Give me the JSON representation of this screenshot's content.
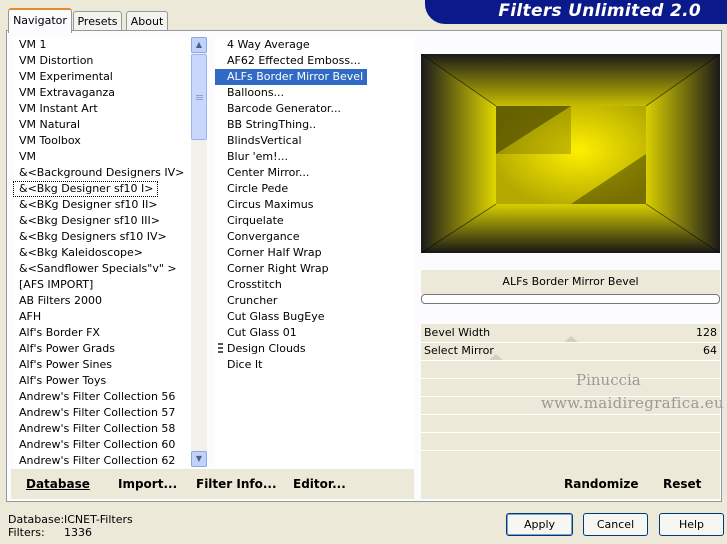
{
  "banner": {
    "title": "Filters Unlimited 2.0"
  },
  "tabs": [
    {
      "label": "Navigator",
      "active": true
    },
    {
      "label": "Presets",
      "active": false
    },
    {
      "label": "About",
      "active": false
    }
  ],
  "categories": {
    "items": [
      "VM 1",
      "VM Distortion",
      "VM Experimental",
      "VM Extravaganza",
      "VM Instant Art",
      "VM Natural",
      "VM Toolbox",
      "VM",
      "&<Background Designers IV>",
      "&<Bkg Designer sf10 I>",
      "&<BKg Designer sf10 II>",
      "&<Bkg Designer sf10 III>",
      "&<Bkg Designers sf10 IV>",
      "&<Bkg Kaleidoscope>",
      "&<Sandflower Specials\"v\" >",
      "[AFS IMPORT]",
      "AB Filters 2000",
      "AFH",
      "Alf's Border FX",
      "Alf's Power Grads",
      "Alf's Power Sines",
      "Alf's Power Toys",
      "Andrew's Filter Collection 56",
      "Andrew's Filter Collection 57",
      "Andrew's Filter Collection 58",
      "Andrew's Filter Collection 60",
      "Andrew's Filter Collection 62"
    ],
    "focused_index": 9
  },
  "filters": {
    "items": [
      "4 Way Average",
      "AF62 Effected Emboss...",
      "ALFs Border Mirror Bevel",
      "Balloons...",
      "Barcode Generator...",
      "BB StringThing..",
      "BlindsVertical",
      "Blur 'em!...",
      "Center Mirror...",
      "Circle Pede",
      "Circus Maximus",
      "Cirquelate",
      "Convergance",
      "Corner Half Wrap",
      "Corner Right Wrap",
      "Crosstitch",
      "Cruncher",
      "Cut Glass  BugEye",
      "Cut Glass 01",
      "Design Clouds",
      "Dice It"
    ],
    "selected_index": 2
  },
  "toolbar": {
    "database": "Database",
    "import": "Import...",
    "filter_info": "Filter Info...",
    "editor": "Editor...",
    "randomize": "Randomize",
    "reset": "Reset"
  },
  "preview": {
    "filter_name": "ALFs Border Mirror Bevel",
    "params": [
      {
        "label": "Bevel Width",
        "value": "128",
        "level": 0.5
      },
      {
        "label": "Select Mirror",
        "value": "64",
        "level": 0.25
      }
    ],
    "watermark_line1": "Pinuccia",
    "watermark_line2": "www.maidiregrafica.eu"
  },
  "status": {
    "database_label": "Database:",
    "database_value": "ICNET-Filters",
    "filters_label": "Filters:",
    "filters_value": "1336"
  },
  "buttons": {
    "apply": "Apply",
    "cancel": "Cancel",
    "help": "Help"
  },
  "colors": {
    "banner": "#0a1a8a",
    "selection": "#316ac5",
    "preview_yellow": "#e8de00"
  }
}
